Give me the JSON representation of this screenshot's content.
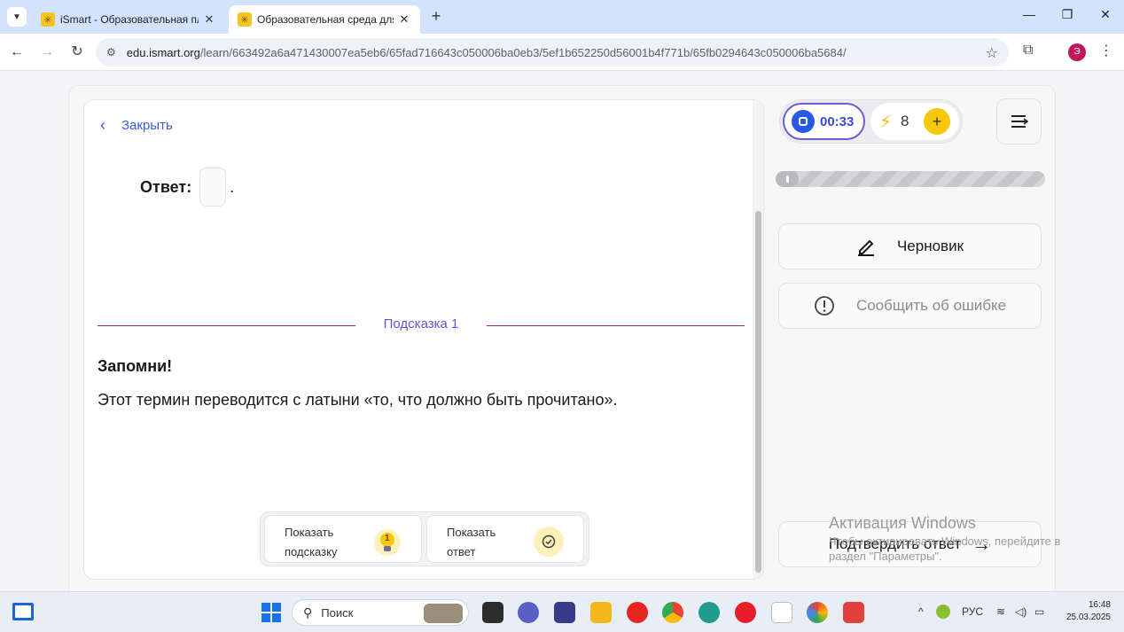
{
  "browser": {
    "tabs": [
      {
        "title": "iSmart - Образовательная пла",
        "active": false
      },
      {
        "title": "Образовательная среда для с",
        "active": true
      }
    ],
    "tab_close_glyph": "✕",
    "new_tab_glyph": "+",
    "url_host": "edu.ismart.org",
    "url_path": "/learn/663492a6a471430007ea5eb6/65fad716643c050006ba0eb3/5ef1b652250d56001b4f771b/65fb0294643c050006ba5684/",
    "profile_initial": "Э"
  },
  "task": {
    "close_label": "Закрыть",
    "answer_label": "Ответ:",
    "answer_value": "",
    "answer_suffix": ".",
    "hint_heading": "Подсказка 1",
    "hint_title": "Запомни!",
    "hint_text": "Этот термин переводится с латыни «то, что должно быть прочитано».",
    "show_hint_label": "Показать подсказку",
    "hint_badge": "1",
    "show_answer_label": "Показать ответ"
  },
  "sidebar": {
    "timer": "00:33",
    "energy": "8",
    "plus_glyph": "+",
    "draft_label": "Черновик",
    "report_label": "Сообщить об ошибке",
    "confirm_label": "Подтвердить ответ",
    "progress_fraction": 0
  },
  "watermark": {
    "title": "Активация Windows",
    "text": "Чтобы активировать Windows, перейдите в раздел \"Параметры\"."
  },
  "taskbar": {
    "search_placeholder": "Поиск",
    "language": "РУС",
    "time": "16:48",
    "date": "25.03.2025"
  },
  "colors": {
    "accent": "#6b4ed8",
    "link": "#3b5bdb",
    "timer_blue": "#2b57e6",
    "energy_yellow": "#f6c70a",
    "divider": "#8a2c7a"
  }
}
